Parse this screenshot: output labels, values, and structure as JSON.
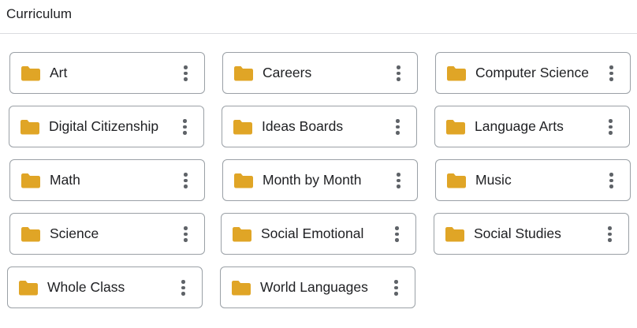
{
  "header": {
    "title": "Curriculum"
  },
  "colors": {
    "folder": "#E0A526",
    "border": "#9AA0A6",
    "divider": "#DADCE0",
    "kebab": "#5F6368"
  },
  "folders": [
    {
      "label": "Art"
    },
    {
      "label": "Careers"
    },
    {
      "label": "Computer Science"
    },
    {
      "label": "Digital Citizenship"
    },
    {
      "label": "Ideas Boards"
    },
    {
      "label": "Language Arts"
    },
    {
      "label": "Math"
    },
    {
      "label": "Month by Month"
    },
    {
      "label": "Music"
    },
    {
      "label": "Science"
    },
    {
      "label": "Social Emotional"
    },
    {
      "label": "Social Studies"
    },
    {
      "label": "Whole Class"
    },
    {
      "label": "World Languages"
    }
  ]
}
